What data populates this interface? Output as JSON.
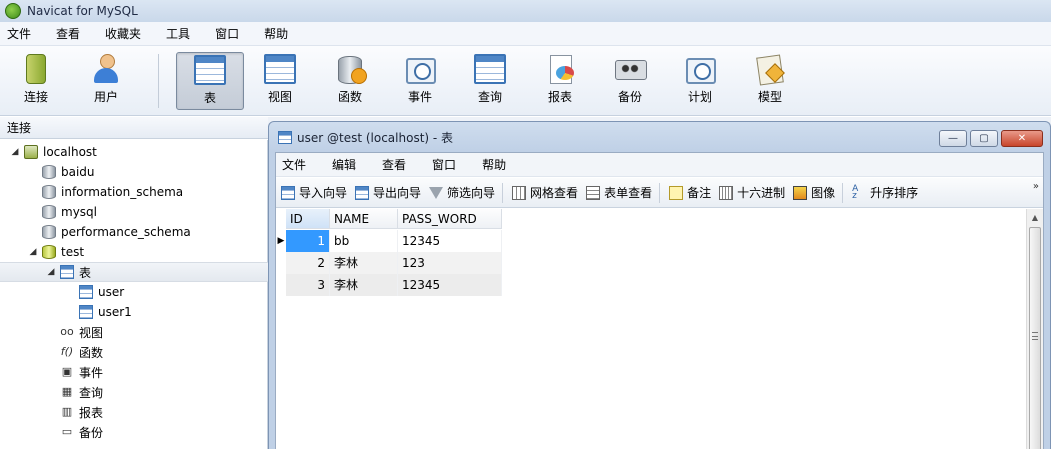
{
  "app": {
    "title": "Navicat for MySQL"
  },
  "menu": [
    "文件",
    "查看",
    "收藏夹",
    "工具",
    "窗口",
    "帮助"
  ],
  "toolbar": {
    "buttons": [
      {
        "label": "连接",
        "icon": "connect-icon"
      },
      {
        "label": "用户",
        "icon": "user-icon"
      },
      {
        "label": "表",
        "icon": "table-icon",
        "active": true
      },
      {
        "label": "视图",
        "icon": "view-icon"
      },
      {
        "label": "函数",
        "icon": "function-icon"
      },
      {
        "label": "事件",
        "icon": "event-icon"
      },
      {
        "label": "查询",
        "icon": "query-icon"
      },
      {
        "label": "报表",
        "icon": "report-icon"
      },
      {
        "label": "备份",
        "icon": "backup-icon"
      },
      {
        "label": "计划",
        "icon": "schedule-icon"
      },
      {
        "label": "模型",
        "icon": "model-icon"
      }
    ]
  },
  "connection_panel": {
    "header": "连接",
    "tree": {
      "server": "localhost",
      "databases": [
        "baidu",
        "information_schema",
        "mysql",
        "performance_schema",
        "test"
      ],
      "tables_folder": "表",
      "tables": [
        "user",
        "user1"
      ],
      "objects": [
        {
          "label": "视图",
          "icon": "glasses-icon",
          "glyph": "oo"
        },
        {
          "label": "函数",
          "icon": "function-icon",
          "glyph": "f()"
        },
        {
          "label": "事件",
          "icon": "event-icon",
          "glyph": "▣"
        },
        {
          "label": "查询",
          "icon": "query-icon",
          "glyph": "▦"
        },
        {
          "label": "报表",
          "icon": "report-icon",
          "glyph": "▥"
        },
        {
          "label": "备份",
          "icon": "backup-icon",
          "glyph": "▭"
        }
      ]
    }
  },
  "table_window": {
    "title": "user @test (localhost) - 表",
    "controls": {
      "minimize": "—",
      "maximize": "▢",
      "close": "✕"
    },
    "menu": [
      "文件",
      "编辑",
      "查看",
      "窗口",
      "帮助"
    ],
    "toolbar": [
      {
        "label": "导入向导",
        "icon": "import-wizard-icon"
      },
      {
        "label": "导出向导",
        "icon": "export-wizard-icon"
      },
      {
        "label": "筛选向导",
        "icon": "filter-icon"
      },
      {
        "label": "网格查看",
        "icon": "grid-view-icon"
      },
      {
        "label": "表单查看",
        "icon": "form-view-icon"
      },
      {
        "label": "备注",
        "icon": "note-icon"
      },
      {
        "label": "十六进制",
        "icon": "hex-icon"
      },
      {
        "label": "图像",
        "icon": "image-icon"
      },
      {
        "label": "升序排序",
        "icon": "sort-ascending-icon"
      }
    ],
    "toolbar_overflow": "»",
    "grid": {
      "columns": [
        "ID",
        "NAME",
        "PASS_WORD"
      ],
      "rows": [
        [
          "1",
          "bb",
          "12345"
        ],
        [
          "2",
          "李林",
          "123"
        ],
        [
          "3",
          "李林",
          "12345"
        ]
      ],
      "current_row_marker": "▶"
    }
  },
  "colors": {
    "selection": "#3399ff",
    "window_border": "#7d94b4",
    "close_button": "#c8452b"
  }
}
